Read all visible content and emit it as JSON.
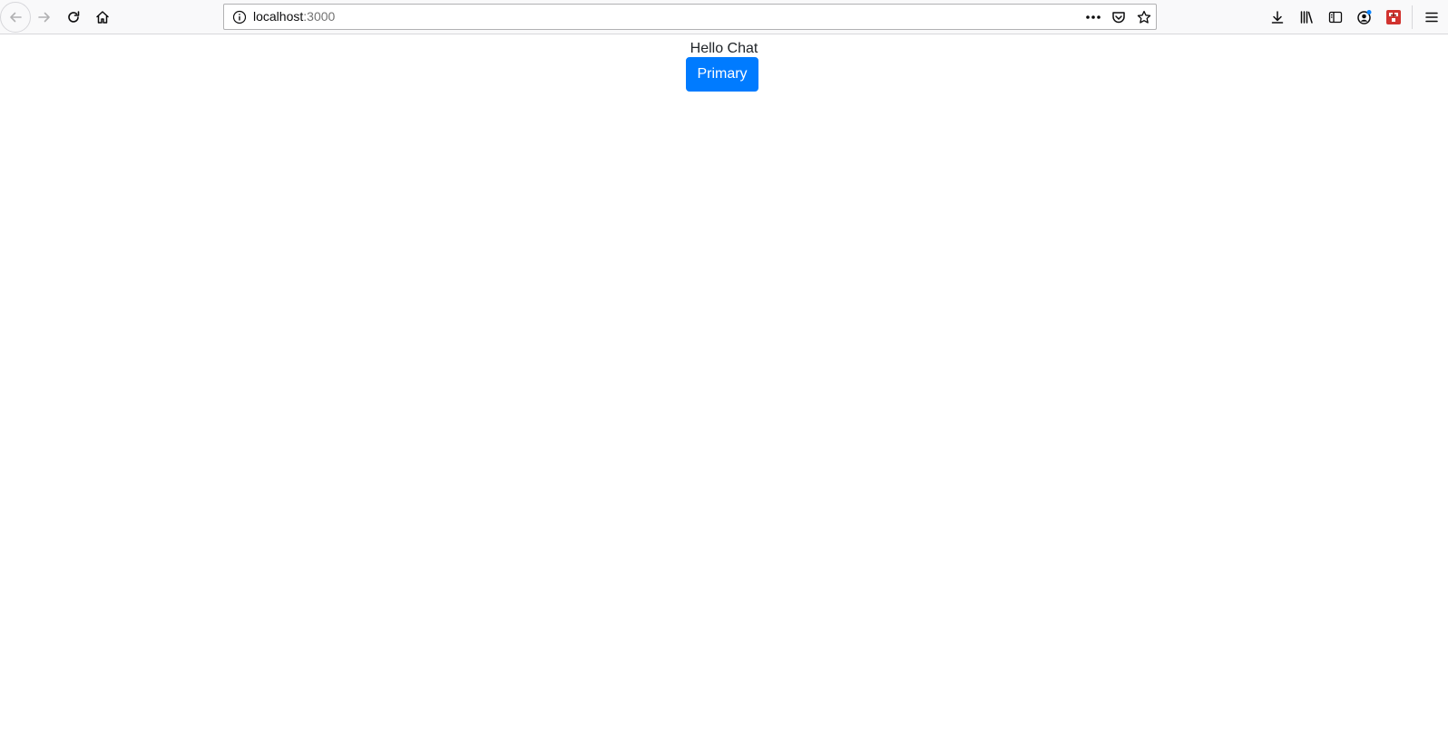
{
  "browser": {
    "url_host": "localhost",
    "url_port": ":3000",
    "icons": {
      "back": "back-arrow-icon",
      "forward": "forward-arrow-icon",
      "reload": "reload-icon",
      "home": "home-icon",
      "site_info": "info-icon",
      "page_actions": "ellipsis-icon",
      "pocket": "pocket-icon",
      "bookmark": "star-icon",
      "downloads": "download-icon",
      "library": "library-icon",
      "sidebar": "sidebar-icon",
      "account": "account-icon",
      "extension": "extension-icon",
      "menu": "hamburger-menu-icon"
    }
  },
  "page": {
    "heading": "Hello Chat",
    "primary_button_label": "Primary"
  },
  "colors": {
    "primary": "#007bff",
    "toolbar_bg": "#f9f9fa",
    "extension_red": "#d1332f",
    "account_badge": "#0a84ff"
  }
}
